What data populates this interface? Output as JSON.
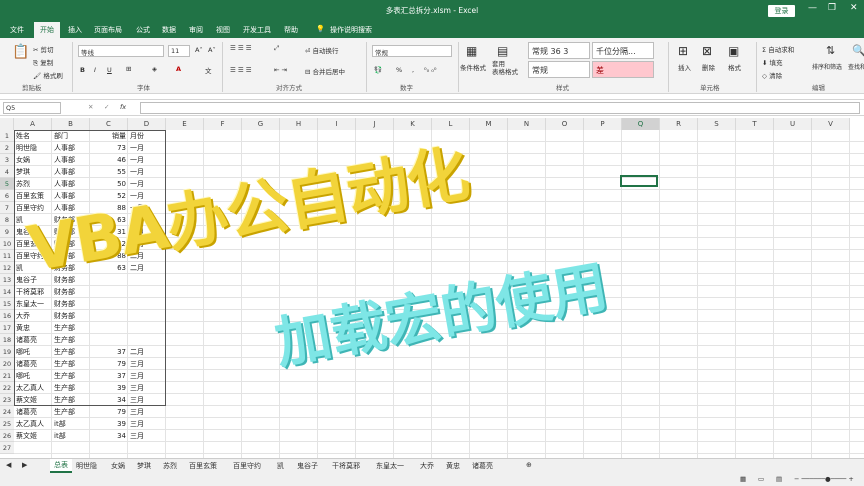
{
  "window": {
    "title": "多表汇总拆分.xlsm  -  Excel",
    "login": "登录",
    "min": "—",
    "restore": "❐",
    "close": "✕"
  },
  "tabs": [
    "文件",
    "开始",
    "插入",
    "页面布局",
    "公式",
    "数据",
    "审阅",
    "视图",
    "开发工具",
    "帮助"
  ],
  "active_tab": "开始",
  "search_label": "操作说明搜索",
  "ribbon": {
    "clipboard": {
      "cut": "剪切",
      "copy": "复制",
      "painter": "格式刷",
      "group": "剪贴板"
    },
    "font": {
      "name": "等线",
      "size": "11",
      "group": "字体",
      "bold": "B",
      "italic": "I",
      "underline": "U"
    },
    "alignment": {
      "wrap": "自动换行",
      "merge": "合并后居中",
      "group": "对齐方式"
    },
    "number": {
      "format": "常规",
      "group": "数字",
      "percent": "%"
    },
    "styles": {
      "cond": "条件格式",
      "table": "套用\n表格格式",
      "s1": "常规 36 3",
      "s2": "千位分隔...",
      "s3": "常规",
      "s4": "差",
      "group": "样式"
    },
    "cells": {
      "insert": "插入",
      "delete": "删除",
      "format": "格式",
      "group": "单元格"
    },
    "editing": {
      "autosum": "自动求和",
      "fill": "填充",
      "clear": "清除",
      "sort": "排序和筛选",
      "find": "查找和选择",
      "group": "编辑"
    }
  },
  "formula_bar": {
    "namebox": "Q5",
    "cancel": "✕",
    "confirm": "✓",
    "fx": "fx",
    "value": ""
  },
  "columns": [
    "A",
    "B",
    "C",
    "D",
    "E",
    "F",
    "G",
    "H",
    "I",
    "J",
    "K",
    "L",
    "M",
    "N",
    "O",
    "P",
    "Q",
    "R",
    "S",
    "T",
    "U",
    "V"
  ],
  "rows": [
    [
      "姓名",
      "部门",
      "销量",
      "月份"
    ],
    [
      "明世隐",
      "人事部",
      "73",
      "一月"
    ],
    [
      "女娲",
      "人事部",
      "46",
      "一月"
    ],
    [
      "梦琪",
      "人事部",
      "55",
      "一月"
    ],
    [
      "苏烈",
      "人事部",
      "50",
      "一月"
    ],
    [
      "百里玄策",
      "人事部",
      "52",
      "一月"
    ],
    [
      "百里守约",
      "人事部",
      "88",
      "一月"
    ],
    [
      "凯",
      "财务部",
      "63",
      "一月"
    ],
    [
      "鬼谷子",
      "财务部",
      "31",
      "一月"
    ],
    [
      "百里玄策",
      "财务部",
      "52",
      "二月"
    ],
    [
      "百里守约",
      "财务部",
      "88",
      "二月"
    ],
    [
      "凯",
      "财务部",
      "63",
      "二月"
    ],
    [
      "鬼谷子",
      "财务部",
      "",
      ""
    ],
    [
      "干将莫邪",
      "财务部",
      "",
      ""
    ],
    [
      "东皇太一",
      "财务部",
      "",
      ""
    ],
    [
      "大乔",
      "财务部",
      "",
      ""
    ],
    [
      "黄忠",
      "生产部",
      "",
      ""
    ],
    [
      "诸葛亮",
      "生产部",
      "",
      ""
    ],
    [
      "哪吒",
      "生产部",
      "37",
      "二月"
    ],
    [
      "诸葛亮",
      "生产部",
      "79",
      "三月"
    ],
    [
      "哪吒",
      "生产部",
      "37",
      "三月"
    ],
    [
      "太乙真人",
      "生产部",
      "39",
      "三月"
    ],
    [
      "蔡文姬",
      "生产部",
      "34",
      "三月"
    ],
    [
      "诸葛亮",
      "生产部",
      "79",
      "三月"
    ],
    [
      "太乙真人",
      "it部",
      "39",
      "三月"
    ],
    [
      "蔡文姬",
      "it部",
      "34",
      "三月"
    ],
    [
      "",
      "",
      "",
      ""
    ],
    [
      "",
      "",
      "",
      ""
    ],
    [
      "",
      "",
      "",
      ""
    ]
  ],
  "sheets": [
    "总表",
    "明世隐",
    "女娲",
    "梦琪",
    "苏烈",
    "百里玄策",
    "百里守约",
    "凯",
    "鬼谷子",
    "干将莫邪",
    "东皇太一",
    "大乔",
    "黄忠",
    "诸葛亮"
  ],
  "active_sheet": "总表",
  "overlay": {
    "line1": "VBA办公自动化",
    "line2": "加载宏的使用"
  },
  "colors": {
    "accent": "#217346",
    "overlay1": "#f2d43a",
    "overlay2": "#7ee6e6"
  }
}
